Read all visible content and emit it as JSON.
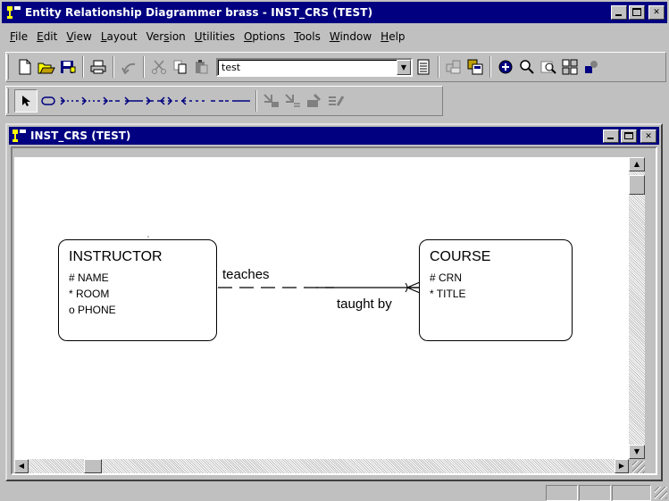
{
  "app": {
    "title": "Entity Relationship Diagrammer brass - INST_CRS (TEST)",
    "window_controls": [
      "minimize",
      "maximize",
      "close"
    ]
  },
  "menu": [
    {
      "label": "File",
      "mnemonic": "F"
    },
    {
      "label": "Edit",
      "mnemonic": "E"
    },
    {
      "label": "View",
      "mnemonic": "V"
    },
    {
      "label": "Layout",
      "mnemonic": "L"
    },
    {
      "label": "Version",
      "mnemonic": "s"
    },
    {
      "label": "Utilities",
      "mnemonic": "U"
    },
    {
      "label": "Options",
      "mnemonic": "O"
    },
    {
      "label": "Tools",
      "mnemonic": "T"
    },
    {
      "label": "Window",
      "mnemonic": "W"
    },
    {
      "label": "Help",
      "mnemonic": "H"
    }
  ],
  "toolbar1": {
    "icons": [
      "new-icon",
      "open-icon",
      "save-icon",
      "print-icon",
      "undo-icon",
      "cut-icon",
      "copy-icon",
      "paste-icon"
    ],
    "combo_value": "test",
    "right_icons": [
      "properties-icon",
      "repository-icon",
      "db-icon",
      "zoom-in-icon",
      "zoom-out-icon",
      "zoom-fit-icon",
      "navigator-icon",
      "tool-icon"
    ]
  },
  "toolbar2": {
    "icons": [
      "pointer-icon",
      "entity-icon",
      "rel-optional-many-icon",
      "rel-optional-one-icon",
      "rel-mandatory-optional-icon",
      "rel-mandatory-one-icon",
      "rel-many-many-icon",
      "rel-many-optional-icon",
      "rel-optional-optional-icon",
      "rel-dashed-icon",
      "rel-solid-icon",
      "autolayout-icon",
      "arcs-icon",
      "mark-icon",
      "annotate-icon"
    ]
  },
  "document": {
    "title": "INST_CRS (TEST)"
  },
  "diagram": {
    "entities": [
      {
        "name": "INSTRUCTOR",
        "attributes": [
          "# NAME",
          "* ROOM",
          "o PHONE"
        ]
      },
      {
        "name": "COURSE",
        "attributes": [
          "# CRN",
          "* TITLE"
        ]
      }
    ],
    "relationship": {
      "from_label": "teaches",
      "to_label": "taught by",
      "from_entity": "INSTRUCTOR",
      "to_entity": "COURSE",
      "from_optionality": "optional",
      "to_optionality": "mandatory",
      "to_cardinality": "many"
    }
  }
}
